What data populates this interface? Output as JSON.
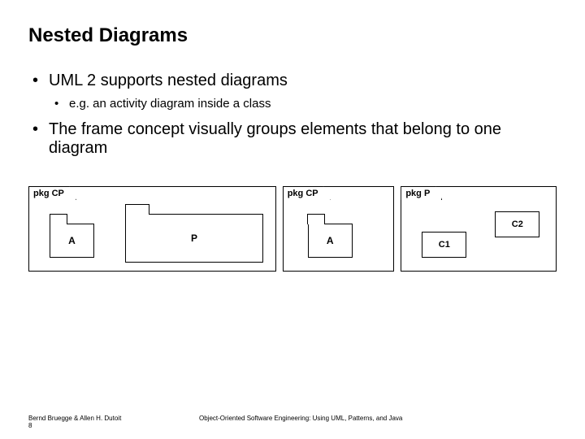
{
  "title": "Nested Diagrams",
  "bullets": {
    "b1": "UML 2 supports nested diagrams",
    "b1a": "e.g. an activity diagram inside a class",
    "b2": "The frame concept visually groups elements that belong to one diagram"
  },
  "frames": {
    "f1": {
      "tab": "pkg CP",
      "pkgA": "A",
      "pkgP": "P"
    },
    "f2": {
      "tab": "pkg CP",
      "pkgA": "A"
    },
    "f3": {
      "tab": "pkg P",
      "c1": "C1",
      "c2": "C2"
    }
  },
  "footer": {
    "authors": "Bernd Bruegge & Allen H. Dutoit",
    "page": "8",
    "book": "Object-Oriented Software Engineering: Using UML, Patterns, and Java"
  }
}
